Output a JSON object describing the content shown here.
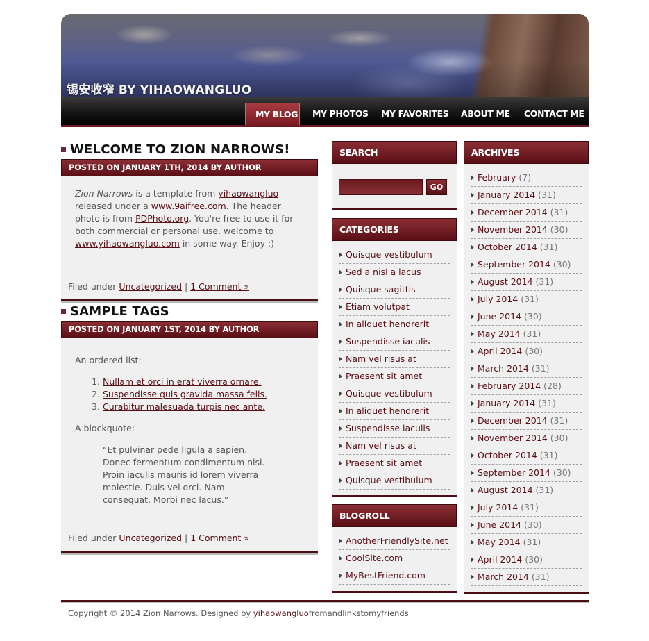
{
  "site": {
    "title": "锡安收窄 BY YIHAOWANGLUO"
  },
  "nav": {
    "items": [
      {
        "label": "MY BLOG",
        "active": true
      },
      {
        "label": "MY PHOTOS"
      },
      {
        "label": "MY FAVORITES"
      },
      {
        "label": "ABOUT ME"
      },
      {
        "label": "CONTACT ME"
      }
    ]
  },
  "posts": [
    {
      "title": "WELCOME TO ZION NARROWS!",
      "meta": "POSTED ON JANUARY 1TH, 2014 BY AUTHOR",
      "intro": {
        "name": "Zion Narrows",
        "t1": " is a template from ",
        "link1": "yihaowangluo",
        "t2": " released under a ",
        "link2": "www.9aifree.com",
        "t3": ". The header photo is from ",
        "link3": "PDPhoto.org",
        "t4": ". You're free to use it for both commercial or personal use. welcome to ",
        "link4": "www.yihaowangluo.com",
        "t5": " in some way. Enjoy :)"
      },
      "filed_under": "Filed under",
      "category": "Uncategorized",
      "sep": "|",
      "comments": "1 Comment »"
    },
    {
      "title": "SAMPLE TAGS",
      "meta": "POSTED ON JANUARY 1ST, 2014 BY AUTHOR",
      "ordered_label": "An ordered list:",
      "ordered_items": [
        "Nullam et orci in erat viverra ornare.",
        "Suspendisse quis gravida massa felis.",
        "Curabitur malesuada turpis nec ante."
      ],
      "blockquote_label": "A blockquote:",
      "blockquote": "“Et pulvinar pede ligula a sapien. Donec fermentum condimentum nisi. Proin iaculis mauris id lorem viverra molestie. Duis vel orci. Nam consequat. Morbi nec lacus.”",
      "filed_under": "Filed under",
      "category": "Uncategorized",
      "sep": "|",
      "comments": "1 Comment »"
    }
  ],
  "search": {
    "heading": "SEARCH",
    "button": "GO",
    "value": ""
  },
  "categories": {
    "heading": "CATEGORIES",
    "items": [
      "Quisque vestibulum",
      "Sed a nisl a lacus",
      "Quisque sagittis",
      "Etiam volutpat",
      "In aliquet hendrerit",
      "Suspendisse iaculis",
      "Nam vel risus at",
      "Praesent sit amet",
      "Quisque vestibulum",
      "In aliquet hendrerit",
      "Suspendisse iaculis",
      "Nam vel risus at",
      "Praesent sit amet",
      "Quisque vestibulum"
    ]
  },
  "blogroll": {
    "heading": "BLOGROLL",
    "items": [
      "AnotherFriendlySite.net",
      "CoolSite.com",
      "MyBestFriend.com"
    ]
  },
  "archives": {
    "heading": "ARCHIVES",
    "items": [
      {
        "label": "February",
        "count": "(7)"
      },
      {
        "label": "January 2014",
        "count": "(31)"
      },
      {
        "label": "December 2014",
        "count": "(31)"
      },
      {
        "label": "November 2014",
        "count": "(30)"
      },
      {
        "label": "October 2014",
        "count": "(31)"
      },
      {
        "label": "September 2014",
        "count": "(30)"
      },
      {
        "label": "August 2014",
        "count": "(31)"
      },
      {
        "label": "July 2014",
        "count": "(31)"
      },
      {
        "label": "June 2014",
        "count": "(30)"
      },
      {
        "label": "May 2014",
        "count": "(31)"
      },
      {
        "label": "April 2014",
        "count": "(30)"
      },
      {
        "label": "March 2014",
        "count": "(31)"
      },
      {
        "label": "February 2014",
        "count": "(28)"
      },
      {
        "label": "January 2014",
        "count": "(31)"
      },
      {
        "label": "December 2014",
        "count": "(31)"
      },
      {
        "label": "November 2014",
        "count": "(30)"
      },
      {
        "label": "October 2014",
        "count": "(31)"
      },
      {
        "label": "September 2014",
        "count": "(30)"
      },
      {
        "label": "August 2014",
        "count": "(31)"
      },
      {
        "label": "July 2014",
        "count": "(31)"
      },
      {
        "label": "June 2014",
        "count": "(30)"
      },
      {
        "label": "May 2014",
        "count": "(31)"
      },
      {
        "label": "April 2014",
        "count": "(30)"
      },
      {
        "label": "March 2014",
        "count": "(31)"
      }
    ]
  },
  "footer": {
    "t1": "Copyright © 2014 Zion Narrows. Designed by ",
    "link": "yihaowangluo",
    "t2": "fromandlinkstomyfriends"
  }
}
